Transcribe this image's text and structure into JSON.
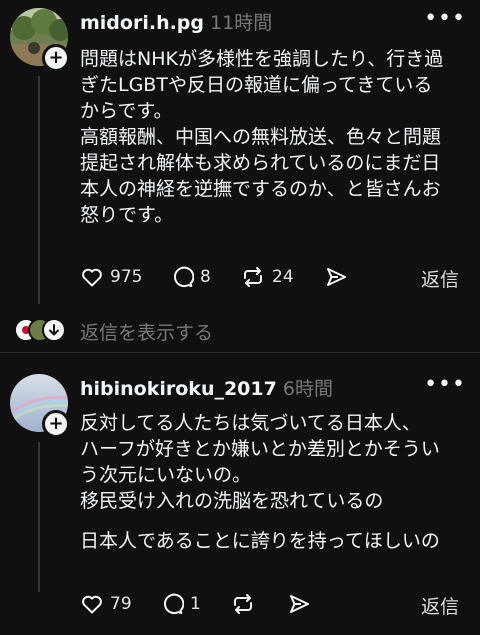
{
  "posts": [
    {
      "username": "midori.h.pg",
      "time": "11時間",
      "more_icon": "more-dots-icon",
      "lines": [
        "問題はNHKが多様性を強調したり、行き過",
        "ぎたLGBTや反日の報道に偏ってきている",
        "からです。",
        "高額報酬、中国への無料放送、色々と問題",
        "提起され解体も求められているのにまだ日",
        "本人の神経を逆撫でするのか、と皆さんお",
        "怒りです。"
      ],
      "likes": "975",
      "comments": "8",
      "reposts": "24",
      "reply_label": "返信"
    },
    {
      "username": "hibinokiroku_2017",
      "time": "6時間",
      "more_icon": "more-dots-icon",
      "lines": [
        "反対してる人たちは気づいてる日本人、",
        "ハーフが好きとか嫌いとか差別とかそうい",
        "う次元にいないの。",
        "移民受け入れの洗脳を恐れているの",
        "",
        "日本人であることに誇りを持ってほしいの"
      ],
      "likes": "79",
      "comments": "1",
      "reposts": "",
      "reply_label": "返信"
    }
  ],
  "show_replies_label": "返信を表示する",
  "colors": {
    "background": "#101010",
    "text": "#f3f5f7",
    "muted": "#777777",
    "divider": "#2d2d2d"
  }
}
